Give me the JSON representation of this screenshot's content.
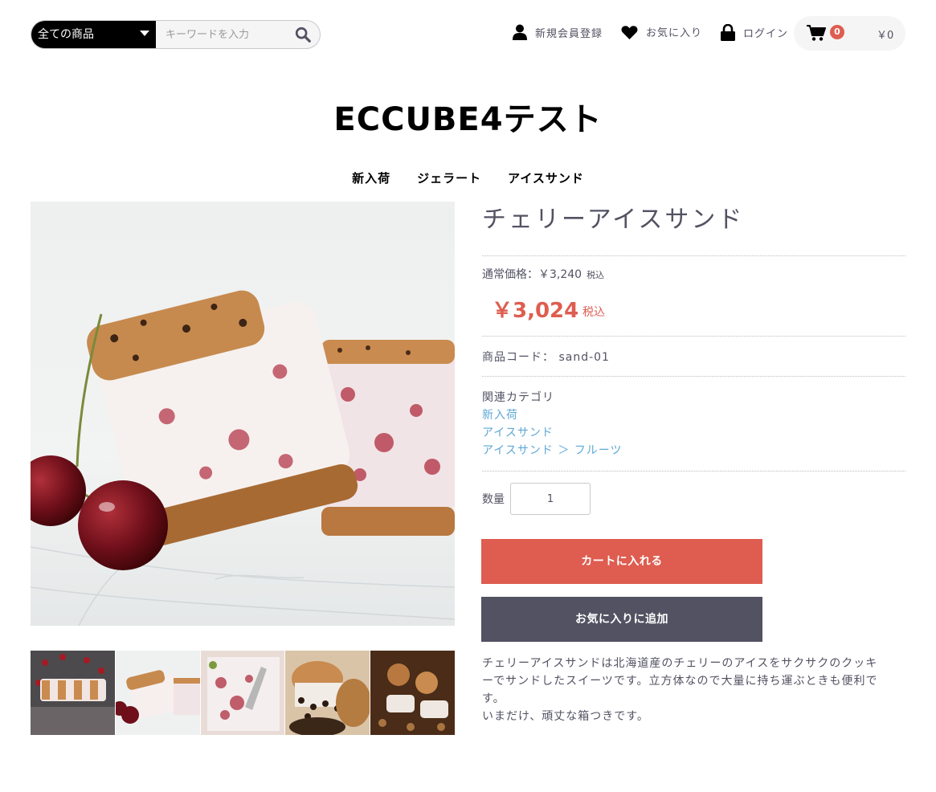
{
  "search": {
    "category_selected": "全ての商品",
    "placeholder": "キーワードを入力",
    "value": ""
  },
  "header_nav": {
    "register": "新規会員登録",
    "favorites": "お気に入り",
    "login": "ログイン"
  },
  "cart": {
    "count": "0",
    "total": "￥0"
  },
  "site_title": "ECCUBE4テスト",
  "global_nav": [
    "新入荷",
    "ジェラート",
    "アイスサンド"
  ],
  "product": {
    "name": "チェリーアイスサンド",
    "regular_price_label": "通常価格：￥3,240",
    "regular_price_tax": "税込",
    "sale_price": "￥3,024",
    "sale_price_tax": "税込",
    "code_label": "商品コード：",
    "code": "sand-01",
    "related_category_label": "関連カテゴリ",
    "related_categories": [
      "新入荷",
      "アイスサンド",
      "アイスサンド ＞ フルーツ"
    ],
    "quantity_label": "数量",
    "quantity": "1",
    "add_to_cart": "カートに入れる",
    "add_to_favorites": "お気に入りに追加",
    "description_lines": [
      "チェリーアイスサンドは北海道産のチェリーのアイスをサクサクのクッキ",
      "ーでサンドしたスイーツです。立方体なので大量に持ち運ぶときも便利で",
      "す。",
      "いまだけ、頑丈な箱つきです。"
    ]
  },
  "colors": {
    "accent_red": "#de5d50",
    "dark_button": "#525263",
    "link": "#5fa8d6",
    "text": "#525263"
  },
  "icons": [
    "search-icon",
    "user-icon",
    "heart-icon",
    "lock-icon",
    "cart-icon"
  ]
}
